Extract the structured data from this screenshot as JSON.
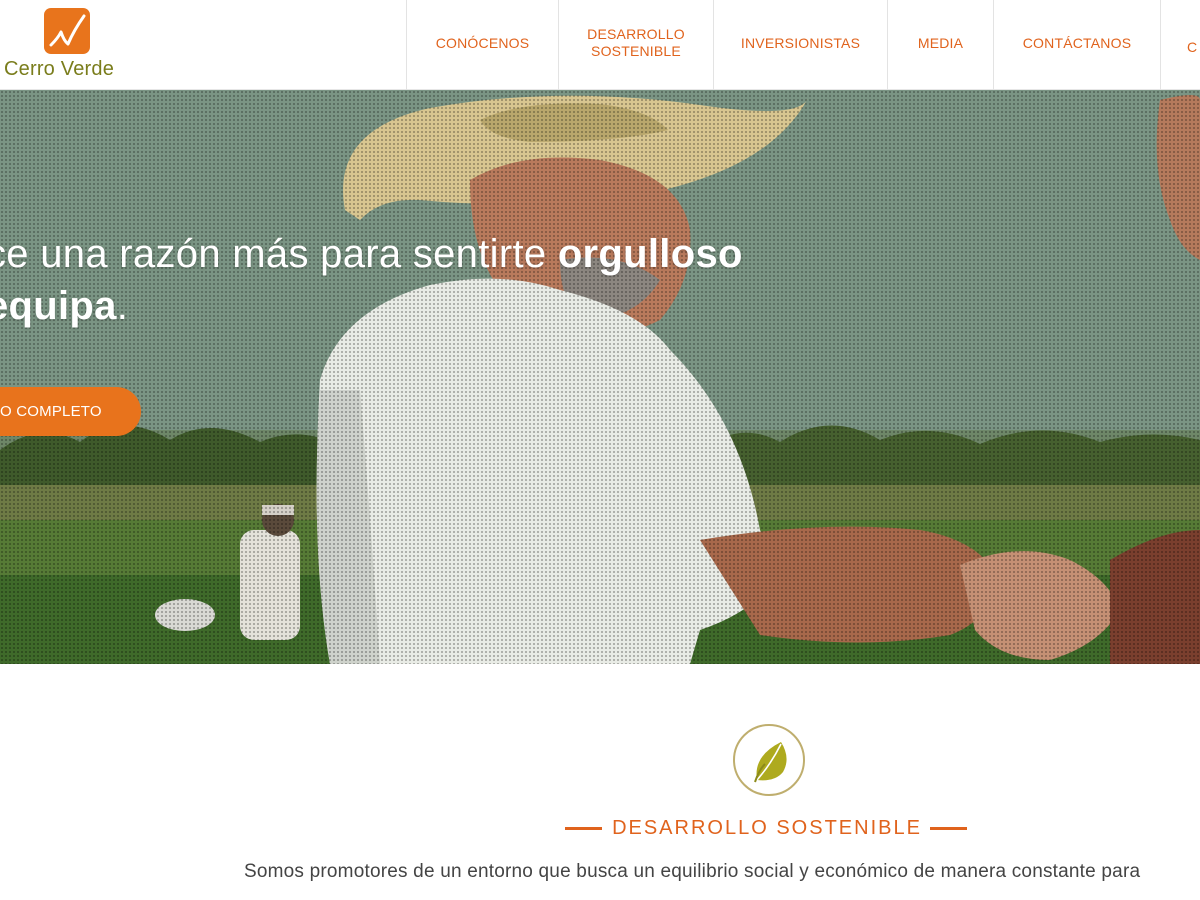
{
  "brand": {
    "name": "Cerro Verde",
    "logo_color": "#e8741c",
    "text_color": "#7a7d1c"
  },
  "nav": {
    "items": [
      {
        "line1": "CONÓCENOS",
        "line2": ""
      },
      {
        "line1": "DESARROLLO",
        "line2": "SOSTENIBLE"
      },
      {
        "line1": "INVERSIONISTAS",
        "line2": ""
      },
      {
        "line1": "MEDIA",
        "line2": ""
      },
      {
        "line1": "CONTÁCTANOS",
        "line2": ""
      }
    ],
    "partial_item": "C"
  },
  "hero": {
    "line1_regular": "ce una razón más para sentirte ",
    "line1_bold": "orgulloso",
    "line2_bold": "equipa",
    "line2_tail": ".",
    "cta_label": "O COMPLETO"
  },
  "sustainability": {
    "icon": "leaf-icon",
    "title": "DESARROLLO SOSTENIBLE",
    "text": "Somos promotores de un entorno que busca un equilibrio social y económico de manera constante para"
  },
  "colors": {
    "accent": "#e0631d",
    "button": "#e8731c",
    "icon_border": "#bfae6e"
  }
}
